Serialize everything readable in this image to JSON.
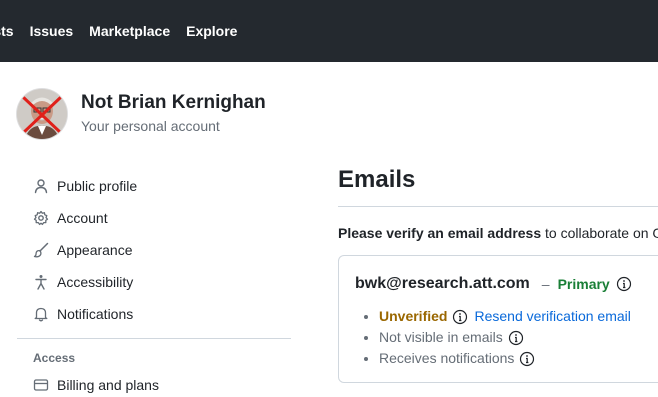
{
  "topnav": {
    "items": [
      "Pull requests",
      "Issues",
      "Marketplace",
      "Explore"
    ],
    "visible_items": [
      "uests",
      "Issues",
      "Marketplace",
      "Explore"
    ]
  },
  "account": {
    "name": "Not Brian Kernighan",
    "subtitle": "Your personal account"
  },
  "sidebar": {
    "items": [
      {
        "label": "Public profile",
        "icon": "person-icon"
      },
      {
        "label": "Account",
        "icon": "gear-icon"
      },
      {
        "label": "Appearance",
        "icon": "paintbrush-icon"
      },
      {
        "label": "Accessibility",
        "icon": "accessibility-icon"
      },
      {
        "label": "Notifications",
        "icon": "bell-icon"
      }
    ],
    "access_heading": "Access",
    "access_items": [
      {
        "label": "Billing and plans",
        "icon": "credit-card-icon"
      }
    ]
  },
  "main": {
    "title": "Emails",
    "verify_bold": "Please verify an email address",
    "verify_rest": " to collaborate on G",
    "email": {
      "address": "bwk@research.att.com",
      "dash": "–",
      "primary_label": "Primary",
      "unverified_label": "Unverified",
      "resend_label": "Resend verification email",
      "details": [
        "Not visible in emails",
        "Receives notifications"
      ]
    }
  },
  "colors": {
    "topbar": "#24292f",
    "primary_green": "#1a7f37",
    "unverified_amber": "#9a6700",
    "link_blue": "#0969da"
  }
}
